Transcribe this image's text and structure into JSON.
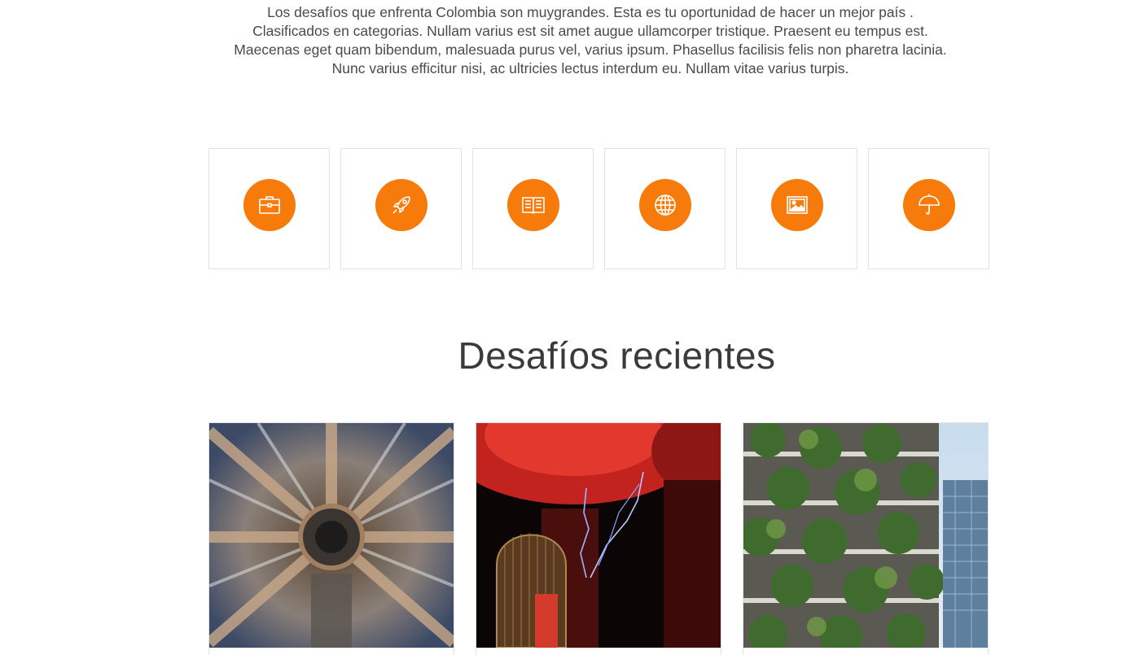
{
  "intro": {
    "lines": [
      "Los desafíos que enfrenta Colombia son muygrandes. Esta es tu oportunidad de hacer un mejor país .",
      "Clasificados en categorias. Nullam varius est sit amet augue ullamcorper tristique. Praesent eu tempus est.",
      "Maecenas eget quam bibendum, malesuada purus vel, varius ipsum. Phasellus facilisis felis non pharetra lacinia.",
      "Nunc varius efficitur nisi, ac ultricies lectus interdum eu. Nullam vitae varius turpis."
    ]
  },
  "features": [
    {
      "icon": "briefcase-icon"
    },
    {
      "icon": "rocket-icon"
    },
    {
      "icon": "book-icon"
    },
    {
      "icon": "globe-icon"
    },
    {
      "icon": "image-icon"
    },
    {
      "icon": "umbrella-icon"
    }
  ],
  "section": {
    "title": "Desafíos recientes"
  },
  "cards": [
    {
      "image": "particle-accelerator-photo"
    },
    {
      "image": "tesla-coil-photo"
    },
    {
      "image": "vertical-forest-building-photo"
    }
  ],
  "colors": {
    "accent": "#f77b0b",
    "border": "#e3e3e3",
    "text": "#4a4a4a"
  }
}
